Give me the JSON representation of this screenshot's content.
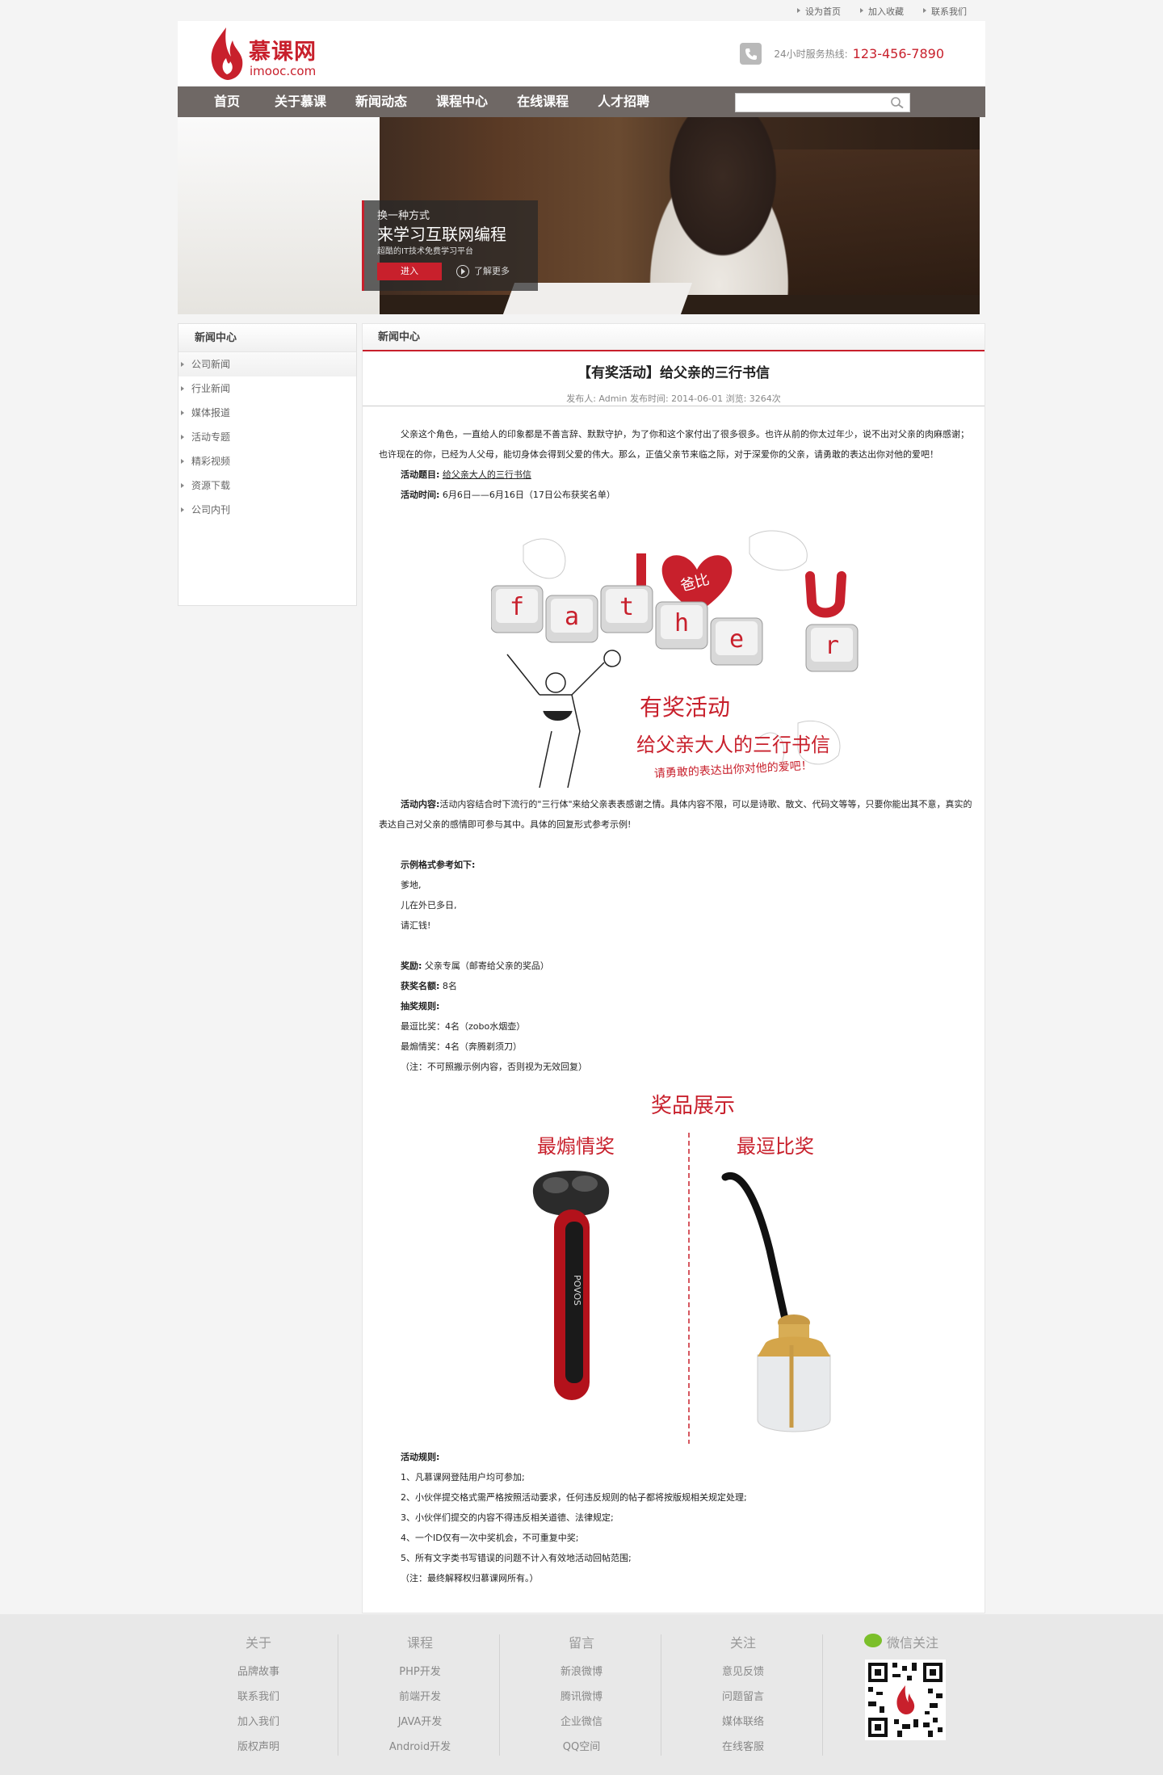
{
  "topbar": {
    "links": [
      "设为首页",
      "加入收藏",
      "联系我们"
    ]
  },
  "header": {
    "logo_name": "慕课网",
    "logo_sub": "imooc.com",
    "hotline_label": "24小时服务热线:",
    "hotline_number": "123-456-7890"
  },
  "nav": {
    "items": [
      "首页",
      "关于慕课",
      "新闻动态",
      "课程中心",
      "在线课程",
      "人才招聘"
    ],
    "search_placeholder": ""
  },
  "banner": {
    "line1": "换一种方式",
    "line2": "来学习互联网编程",
    "line3": "超酷的IT技术免费学习平台",
    "enter_button": "进入",
    "more_button": "了解更多"
  },
  "sidebar": {
    "title": "新闻中心",
    "items": [
      "公司新闻",
      "行业新闻",
      "媒体报道",
      "活动专题",
      "精彩视频",
      "资源下载",
      "公司内刊"
    ]
  },
  "article": {
    "section_title": "新闻中心",
    "title": "【有奖活动】给父亲的三行书信",
    "meta": "发布人: Admin 发布时间: 2014-06-01 浏览: 3264次",
    "intro": "父亲这个角色，一直给人的印象都是不善言辞、默默守护，为了你和这个家付出了很多很多。也许从前的你太过年少，说不出对父亲的肉麻感谢；也许现在的你，已经为人父母，能切身体会得到父爱的伟大。那么，正值父亲节来临之际，对于深爱你的父亲，请勇敢的表达出你对他的爱吧！",
    "topic_label": "活动题目:",
    "topic_value": "给父亲大人的三行书信",
    "time_label": "活动时间:",
    "time_value": "6月6日——6月16日（17日公布获奖名单）",
    "content_label": "活动内容:",
    "content_value": "活动内容结合时下流行的\"三行体\"来给父亲表表感谢之情。具体内容不限，可以是诗歌、散文、代码文等等，只要你能出其不意，真实的表达自己对父亲的感情即可参与其中。具体的回复形式参考示例!",
    "example_label": "示例格式参考如下:",
    "example_lines": [
      "爹地,",
      "儿在外已多日,",
      "请汇钱!"
    ],
    "prize_label": "奖励:",
    "prize_value": "父亲专属（邮寄给父亲的奖品）",
    "count_label": "获奖名额:",
    "count_value": "8名",
    "rule_label": "抽奖规则:",
    "rule_lines": [
      "最逗比奖：4名（zobo水烟壶）",
      "最煽情奖：4名（奔腾剃须刀）",
      "（注：不可照搬示例内容，否则视为无效回复）"
    ],
    "activity_rules_label": "活动规则:",
    "activity_rules": [
      "1、凡慕课网登陆用户均可参加;",
      "2、小伙伴提交格式需严格按照活动要求，任何违反规则的帖子都将按版规相关规定处理;",
      "3、小伙伴们提交的内容不得违反相关道德、法律规定;",
      "4、一个ID仅有一次中奖机会，不可重复中奖;",
      "5、所有文字类书写错误的问题不计入有效地活动回帖范围;",
      "（注：最终解释权归慕课网所有。）"
    ]
  },
  "image1": {
    "heart_text": "爸比",
    "word": "father",
    "caption1": "有奖活动",
    "caption2": "给父亲大人的三行书信",
    "caption3": "请勇敢的表达出你对他的爱吧！"
  },
  "image2": {
    "title": "奖品展示",
    "left_label": "最煽情奖",
    "right_label": "最逗比奖",
    "shaver_brand": "POVOS"
  },
  "footer": {
    "columns": [
      {
        "title": "关于",
        "links": [
          "品牌故事",
          "联系我们",
          "加入我们",
          "版权声明"
        ]
      },
      {
        "title": "课程",
        "links": [
          "PHP开发",
          "前端开发",
          "JAVA开发",
          "Android开发"
        ]
      },
      {
        "title": "留言",
        "links": [
          "新浪微博",
          "腾讯微博",
          "企业微信",
          "QQ空间"
        ]
      },
      {
        "title": "关注",
        "links": [
          "意见反馈",
          "问题留言",
          "媒体联络",
          "在线客服"
        ]
      }
    ],
    "wechat_title": "微信关注"
  },
  "colors": {
    "brand": "#c8202c",
    "nav_bg": "#6f6865"
  }
}
